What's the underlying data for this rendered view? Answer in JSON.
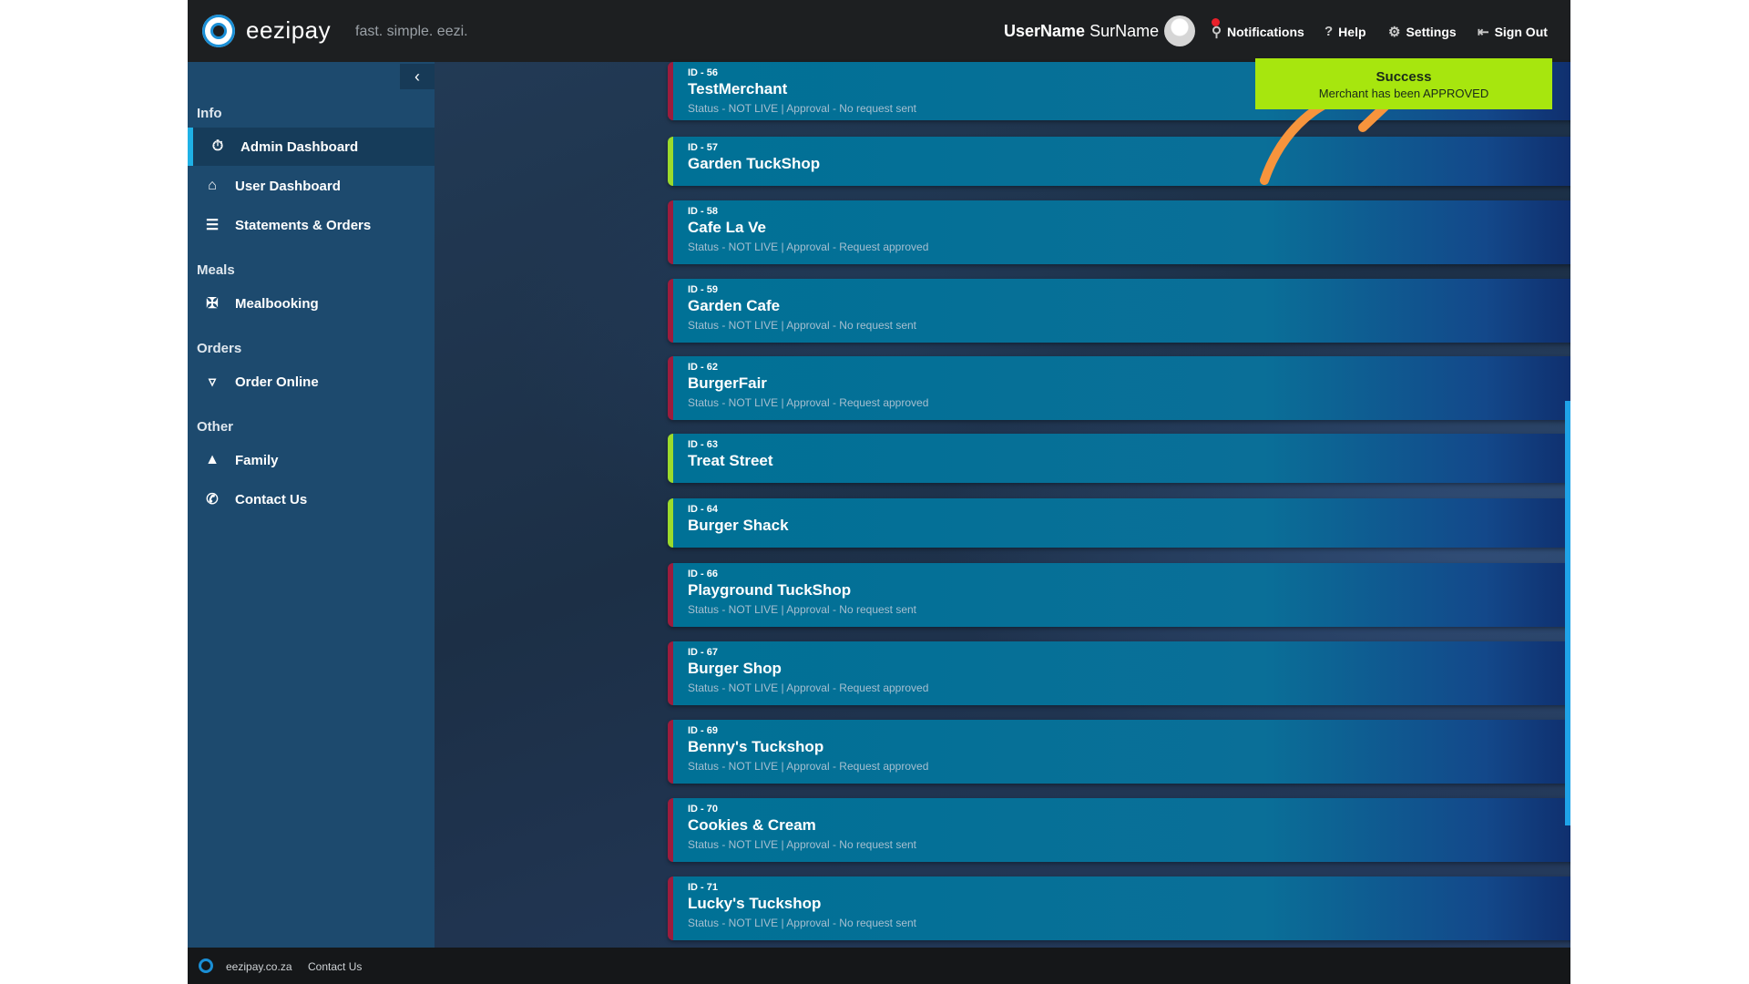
{
  "header": {
    "brand": "eezipay",
    "tagline": "fast. simple. eezi.",
    "user_first": "UserName",
    "user_last": "SurName",
    "notifications": "Notifications",
    "help": "Help",
    "settings": "Settings",
    "sign_out": "Sign Out",
    "icons": {
      "notifications": "bell-icon",
      "help": "question-icon",
      "settings": "gear-icon",
      "sign_out": "sign-out-icon"
    }
  },
  "sidebar": {
    "sections": [
      {
        "label": "Info",
        "items": [
          {
            "label": "Admin Dashboard",
            "icon": "dashboard-icon",
            "active": true
          },
          {
            "label": "User Dashboard",
            "icon": "home-icon"
          },
          {
            "label": "Statements & Orders",
            "icon": "list-icon"
          }
        ]
      },
      {
        "label": "Meals",
        "items": [
          {
            "label": "Mealbooking",
            "icon": "utensils-icon"
          }
        ]
      },
      {
        "label": "Orders",
        "items": [
          {
            "label": "Order Online",
            "icon": "basket-icon"
          }
        ]
      },
      {
        "label": "Other",
        "items": [
          {
            "label": "Family",
            "icon": "family-icon"
          },
          {
            "label": "Contact Us",
            "icon": "phone-icon"
          }
        ]
      }
    ]
  },
  "merchants": [
    {
      "id": "ID - 56",
      "name": "TestMerchant",
      "status": "Status - NOT LIVE | Approval - No request sent"
    },
    {
      "id": "ID - 57",
      "name": "Garden TuckShop",
      "status": ""
    },
    {
      "id": "ID - 58",
      "name": "Cafe La Ve",
      "status": "Status - NOT LIVE | Approval - Request approved"
    },
    {
      "id": "ID - 59",
      "name": "Garden Cafe",
      "status": "Status - NOT LIVE | Approval - No request sent"
    },
    {
      "id": "ID - 62",
      "name": "BurgerFair",
      "status": "Status - NOT LIVE | Approval - Request approved"
    },
    {
      "id": "ID - 63",
      "name": "Treat Street",
      "status": ""
    },
    {
      "id": "ID - 64",
      "name": "Burger Shack",
      "status": ""
    },
    {
      "id": "ID - 66",
      "name": "Playground TuckShop",
      "status": "Status - NOT LIVE | Approval - No request sent"
    },
    {
      "id": "ID - 67",
      "name": "Burger Shop",
      "status": "Status - NOT LIVE | Approval - Request approved"
    },
    {
      "id": "ID - 69",
      "name": "Benny's Tuckshop",
      "status": "Status - NOT LIVE | Approval - Request approved"
    },
    {
      "id": "ID - 70",
      "name": "Cookies & Cream",
      "status": "Status - NOT LIVE | Approval - No request sent"
    },
    {
      "id": "ID - 71",
      "name": "Lucky's Tuckshop",
      "status": "Status - NOT LIVE | Approval - No request sent"
    }
  ],
  "toast": {
    "title": "Success",
    "message": "Merchant has been APPROVED"
  },
  "footer": {
    "site": "eezipay.co.za",
    "contact": "Contact Us"
  },
  "colors": {
    "live_accent": "#9bdb2c",
    "not_live_accent": "#9c1c3d",
    "toast_bg": "#a7e60e",
    "arrow": "#f7943c"
  }
}
